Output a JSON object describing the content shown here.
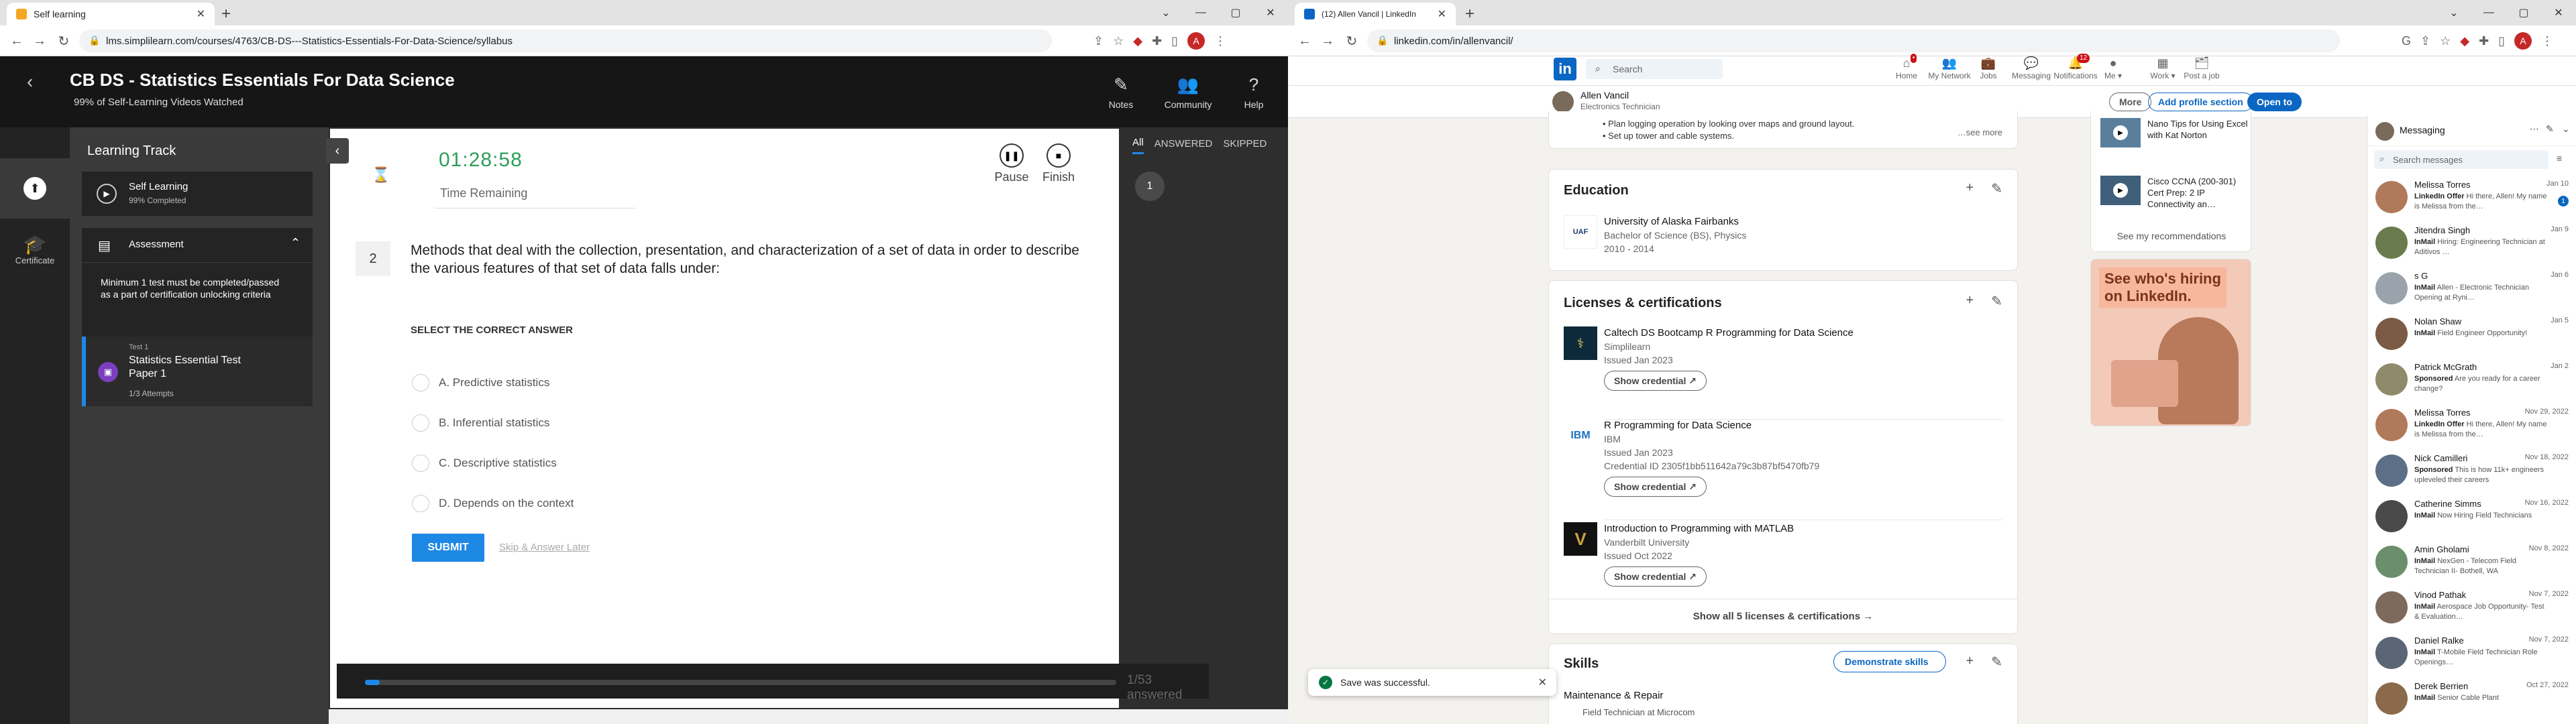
{
  "left_browser": {
    "tab_title": "Self learning",
    "url": "lms.simplilearn.com/courses/4763/CB-DS---Statistics-Essentials-For-Data-Science/syllabus",
    "avatar": "A"
  },
  "course": {
    "title": "CB DS - Statistics Essentials For Data Science",
    "progress_text": "99% of Self-Learning Videos Watched",
    "header_actions": [
      {
        "label": "Notes",
        "icon": "notes-icon"
      },
      {
        "label": "Community",
        "icon": "community-icon"
      },
      {
        "label": "Help",
        "icon": "help-icon"
      }
    ],
    "rail_certificate": "Certificate",
    "learning_track_title": "Learning Track",
    "self_learning": {
      "label": "Self Learning",
      "sub": "99% Completed"
    },
    "assessment": {
      "label": "Assessment",
      "note": "Minimum 1 test must be completed/passed as a part of certification unlocking criteria"
    },
    "test": {
      "over": "Test 1",
      "name": "Statistics Essential Test Paper 1",
      "attempts": "1/3 Attempts"
    },
    "timer": "01:28:58",
    "time_remaining": "Time Remaining",
    "pause": "Pause",
    "finish": "Finish",
    "question_number": "2",
    "question": "Methods that deal with the collection, presentation, and characterization of a set of data in order to describe the various features of that set of data falls under:",
    "instruction": "SELECT THE CORRECT ANSWER",
    "options": [
      {
        "letter": "A.",
        "text": "Predictive statistics"
      },
      {
        "letter": "B.",
        "text": "Inferential statistics"
      },
      {
        "letter": "C.",
        "text": "Descriptive statistics"
      },
      {
        "letter": "D.",
        "text": "Depends on the context"
      }
    ],
    "submit": "SUBMIT",
    "skip": "Skip & Answer Later",
    "filters": [
      "All",
      "ANSWERED",
      "SKIPPED"
    ],
    "question_chip": "1",
    "answered": "1/53 answered",
    "answered_fraction": 0.02
  },
  "right_browser": {
    "tab_title": "(12) Allen Vancil | LinkedIn",
    "url": "linkedin.com/in/allenvancil/"
  },
  "linkedin": {
    "search_placeholder": "Search",
    "nav": [
      {
        "label": "Home",
        "icon": "home-icon",
        "badge": ""
      },
      {
        "label": "My Network",
        "icon": "network-icon",
        "badge": ""
      },
      {
        "label": "Jobs",
        "icon": "jobs-icon",
        "badge": ""
      },
      {
        "label": "Messaging",
        "icon": "messaging-icon",
        "badge": ""
      },
      {
        "label": "Notifications",
        "icon": "bell-icon",
        "badge": "12"
      },
      {
        "label": "Me ▾",
        "icon": "me-icon",
        "badge": ""
      },
      {
        "label": "Work ▾",
        "icon": "grid-icon",
        "badge": ""
      },
      {
        "label": "Post a job",
        "icon": "briefcase-icon",
        "badge": ""
      }
    ],
    "profile": {
      "name": "Allen Vancil",
      "headline": "Electronics Technician"
    },
    "more": "More",
    "add_section": "Add profile section",
    "open_to": "Open to",
    "experience_bullets": [
      "• Plan logging operation by looking over maps and ground layout.",
      "• Set up tower and cable systems."
    ],
    "see_more": "…see more",
    "education": {
      "title": "Education",
      "school": "University of Alaska Fairbanks",
      "degree": "Bachelor of Science (BS), Physics",
      "years": "2010 - 2014"
    },
    "licenses": {
      "title": "Licenses & certifications",
      "items": [
        {
          "name": "Caltech DS Bootcamp R Programming for Data Science",
          "org": "Simplilearn",
          "issued": "Issued Jan 2023",
          "cred": "",
          "button": "Show credential"
        },
        {
          "name": "R Programming for Data Science",
          "org": "IBM",
          "issued": "Issued Jan 2023",
          "cred": "Credential ID 2305f1bb511642a79c3b87bf5470fb79",
          "button": "Show credential"
        },
        {
          "name": "Introduction to Programming with MATLAB",
          "org": "Vanderbilt University",
          "issued": "Issued Oct 2022",
          "cred": "",
          "button": "Show credential"
        }
      ],
      "show_all": "Show all 5 licenses & certifications →"
    },
    "skills": {
      "title": "Skills",
      "demonstrate": "Demonstrate skills",
      "first": "Maintenance & Repair",
      "sub": "Field Technician at Microcom"
    },
    "aside": {
      "courses": [
        "Nano Tips for Using Excel with Kat Norton",
        "Cisco CCNA (200-301) Cert Prep: 2 IP Connectivity an…"
      ],
      "see_recs": "See my recommendations",
      "ad_line1": "See who's hiring",
      "ad_line2": "on LinkedIn."
    },
    "toast": "Save was successful.",
    "messaging": {
      "title": "Messaging",
      "search": "Search messages",
      "rows": [
        {
          "name": "Melissa Torres",
          "date": "Jan 10",
          "tag": "LinkedIn Offer",
          "preview": "Hi there, Allen! My name is Melissa from the…",
          "unread": "1",
          "color": "#b07a5a"
        },
        {
          "name": "Jitendra Singh",
          "date": "Jan 9",
          "tag": "InMail",
          "preview": "Hiring: Engineering Technician at Aditivos …",
          "unread": "",
          "color": "#6a7b4e"
        },
        {
          "name": "s G",
          "date": "Jan 6",
          "tag": "InMail",
          "preview": "Allen - Electronic Technician Opening at Ryni…",
          "unread": "",
          "color": "#9aa3ab"
        },
        {
          "name": "Nolan Shaw",
          "date": "Jan 5",
          "tag": "InMail",
          "preview": "Field Engineer Opportunity!",
          "unread": "",
          "color": "#7b5b45"
        },
        {
          "name": "Patrick McGrath",
          "date": "Jan 2",
          "tag": "Sponsored",
          "preview": "Are you ready for a career change?",
          "unread": "",
          "color": "#8f8a6a"
        },
        {
          "name": "Melissa Torres",
          "date": "Nov 29, 2022",
          "tag": "LinkedIn Offer",
          "preview": "Hi there, Allen! My name is Melissa from the…",
          "unread": "",
          "color": "#b07a5a"
        },
        {
          "name": "Nick Camilleri",
          "date": "Nov 18, 2022",
          "tag": "Sponsored",
          "preview": "This is how 11k+ engineers upleveled their careers",
          "unread": "",
          "color": "#5d6f86"
        },
        {
          "name": "Catherine Simms",
          "date": "Nov 16, 2022",
          "tag": "InMail",
          "preview": "Now Hiring Field Technicians",
          "unread": "",
          "color": "#4a4a4a"
        },
        {
          "name": "Amin Gholami",
          "date": "Nov 8, 2022",
          "tag": "InMail",
          "preview": "NexGen - Telecom Field Technician II- Bothell, WA",
          "unread": "",
          "color": "#6b8e6b"
        },
        {
          "name": "Vinod Pathak",
          "date": "Nov 7, 2022",
          "tag": "InMail",
          "preview": "Aerospace Job Opportunity- Test & Evaluation…",
          "unread": "",
          "color": "#7d6a5c"
        },
        {
          "name": "Daniel Ralke",
          "date": "Nov 7, 2022",
          "tag": "InMail",
          "preview": "T-Mobile Field Technician Role Openings…",
          "unread": "",
          "color": "#5a6675"
        },
        {
          "name": "Derek Berrien",
          "date": "Oct 27, 2022",
          "tag": "InMail",
          "preview": "Senior Cable Plant",
          "unread": "",
          "color": "#8a6a4a"
        }
      ]
    }
  }
}
